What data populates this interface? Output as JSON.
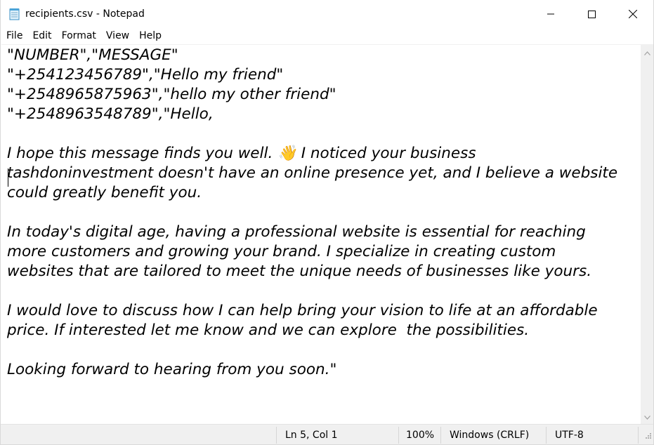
{
  "window": {
    "title": "recipients.csv - Notepad",
    "icon": "notepad-icon"
  },
  "controls": {
    "minimize": "minimize-icon",
    "maximize": "maximize-icon",
    "close": "close-icon"
  },
  "menu": {
    "items": [
      "File",
      "Edit",
      "Format",
      "View",
      "Help"
    ]
  },
  "editor": {
    "content": "\"NUMBER\",\"MESSAGE\"\n\"+254123456789\",\"Hello my friend\"\n\"+2548965875963\",\"hello my other friend\"\n\"+2548963548789\",\"Hello,\n\nI hope this message finds you well. 👋 I noticed your business\ntashdoninvestment doesn't have an online presence yet, and I believe a website\ncould greatly benefit you.\n\nIn today's digital age, having a professional website is essential for reaching\nmore customers and growing your brand. I specialize in creating custom\nwebsites that are tailored to meet the unique needs of businesses like yours.\n\nI would love to discuss how I can help bring your vision to life at an affordable\nprice. If interested let me know and we can explore  the possibilities.\n\nLooking forward to hearing from you soon.\""
  },
  "status": {
    "position": "Ln 5, Col 1",
    "zoom": "100%",
    "line_ending": "Windows (CRLF)",
    "encoding": "UTF-8"
  }
}
